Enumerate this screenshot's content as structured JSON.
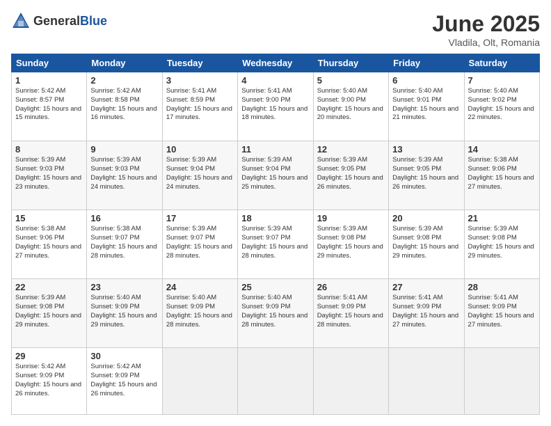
{
  "logo": {
    "general": "General",
    "blue": "Blue"
  },
  "title": "June 2025",
  "location": "Vladila, Olt, Romania",
  "weekdays": [
    "Sunday",
    "Monday",
    "Tuesday",
    "Wednesday",
    "Thursday",
    "Friday",
    "Saturday"
  ],
  "weeks": [
    [
      {
        "day": "1",
        "sunrise": "5:42 AM",
        "sunset": "8:57 PM",
        "daylight": "15 hours and 15 minutes."
      },
      {
        "day": "2",
        "sunrise": "5:42 AM",
        "sunset": "8:58 PM",
        "daylight": "15 hours and 16 minutes."
      },
      {
        "day": "3",
        "sunrise": "5:41 AM",
        "sunset": "8:59 PM",
        "daylight": "15 hours and 17 minutes."
      },
      {
        "day": "4",
        "sunrise": "5:41 AM",
        "sunset": "9:00 PM",
        "daylight": "15 hours and 18 minutes."
      },
      {
        "day": "5",
        "sunrise": "5:40 AM",
        "sunset": "9:00 PM",
        "daylight": "15 hours and 20 minutes."
      },
      {
        "day": "6",
        "sunrise": "5:40 AM",
        "sunset": "9:01 PM",
        "daylight": "15 hours and 21 minutes."
      },
      {
        "day": "7",
        "sunrise": "5:40 AM",
        "sunset": "9:02 PM",
        "daylight": "15 hours and 22 minutes."
      }
    ],
    [
      {
        "day": "8",
        "sunrise": "5:39 AM",
        "sunset": "9:03 PM",
        "daylight": "15 hours and 23 minutes."
      },
      {
        "day": "9",
        "sunrise": "5:39 AM",
        "sunset": "9:03 PM",
        "daylight": "15 hours and 24 minutes."
      },
      {
        "day": "10",
        "sunrise": "5:39 AM",
        "sunset": "9:04 PM",
        "daylight": "15 hours and 24 minutes."
      },
      {
        "day": "11",
        "sunrise": "5:39 AM",
        "sunset": "9:04 PM",
        "daylight": "15 hours and 25 minutes."
      },
      {
        "day": "12",
        "sunrise": "5:39 AM",
        "sunset": "9:05 PM",
        "daylight": "15 hours and 26 minutes."
      },
      {
        "day": "13",
        "sunrise": "5:39 AM",
        "sunset": "9:05 PM",
        "daylight": "15 hours and 26 minutes."
      },
      {
        "day": "14",
        "sunrise": "5:38 AM",
        "sunset": "9:06 PM",
        "daylight": "15 hours and 27 minutes."
      }
    ],
    [
      {
        "day": "15",
        "sunrise": "5:38 AM",
        "sunset": "9:06 PM",
        "daylight": "15 hours and 27 minutes."
      },
      {
        "day": "16",
        "sunrise": "5:38 AM",
        "sunset": "9:07 PM",
        "daylight": "15 hours and 28 minutes."
      },
      {
        "day": "17",
        "sunrise": "5:39 AM",
        "sunset": "9:07 PM",
        "daylight": "15 hours and 28 minutes."
      },
      {
        "day": "18",
        "sunrise": "5:39 AM",
        "sunset": "9:07 PM",
        "daylight": "15 hours and 28 minutes."
      },
      {
        "day": "19",
        "sunrise": "5:39 AM",
        "sunset": "9:08 PM",
        "daylight": "15 hours and 29 minutes."
      },
      {
        "day": "20",
        "sunrise": "5:39 AM",
        "sunset": "9:08 PM",
        "daylight": "15 hours and 29 minutes."
      },
      {
        "day": "21",
        "sunrise": "5:39 AM",
        "sunset": "9:08 PM",
        "daylight": "15 hours and 29 minutes."
      }
    ],
    [
      {
        "day": "22",
        "sunrise": "5:39 AM",
        "sunset": "9:08 PM",
        "daylight": "15 hours and 29 minutes."
      },
      {
        "day": "23",
        "sunrise": "5:40 AM",
        "sunset": "9:09 PM",
        "daylight": "15 hours and 29 minutes."
      },
      {
        "day": "24",
        "sunrise": "5:40 AM",
        "sunset": "9:09 PM",
        "daylight": "15 hours and 28 minutes."
      },
      {
        "day": "25",
        "sunrise": "5:40 AM",
        "sunset": "9:09 PM",
        "daylight": "15 hours and 28 minutes."
      },
      {
        "day": "26",
        "sunrise": "5:41 AM",
        "sunset": "9:09 PM",
        "daylight": "15 hours and 28 minutes."
      },
      {
        "day": "27",
        "sunrise": "5:41 AM",
        "sunset": "9:09 PM",
        "daylight": "15 hours and 27 minutes."
      },
      {
        "day": "28",
        "sunrise": "5:41 AM",
        "sunset": "9:09 PM",
        "daylight": "15 hours and 27 minutes."
      }
    ],
    [
      {
        "day": "29",
        "sunrise": "5:42 AM",
        "sunset": "9:09 PM",
        "daylight": "15 hours and 26 minutes."
      },
      {
        "day": "30",
        "sunrise": "5:42 AM",
        "sunset": "9:09 PM",
        "daylight": "15 hours and 26 minutes."
      },
      null,
      null,
      null,
      null,
      null
    ]
  ]
}
